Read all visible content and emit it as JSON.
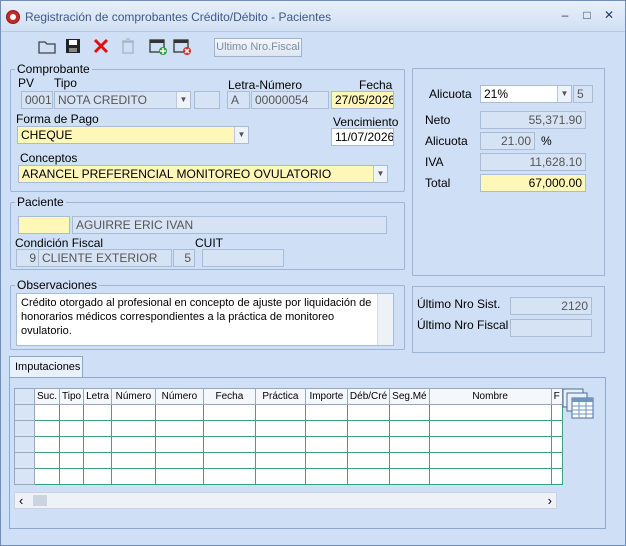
{
  "window": {
    "title": "Registración de comprobantes Crédito/Débito - Pacientes",
    "minimize": "‒",
    "maximize": "□",
    "close": "✕"
  },
  "toolbar": {
    "fiscal_label": "Ultimo Nro.Fiscal"
  },
  "comprobante": {
    "legend": "Comprobante",
    "pv_label": "PV",
    "pv_value": "0001",
    "tipo_label": "Tipo",
    "tipo_value": "NOTA CREDITO",
    "letra_numero_label": "Letra-Número",
    "letra_value": "A",
    "numero_value": "00000054",
    "fecha_label": "Fecha",
    "fecha_value": "27/05/2026",
    "forma_pago_label": "Forma de Pago",
    "forma_pago_value": "CHEQUE",
    "vencimiento_label": "Vencimiento",
    "vencimiento_value": "11/07/2026",
    "conceptos_label": "Conceptos",
    "conceptos_value": "ARANCEL PREFERENCIAL  MONITOREO OVULATORIO"
  },
  "paciente": {
    "legend": "Paciente",
    "codigo_value": "",
    "nombre_value": "AGUIRRE ERIC IVAN",
    "condicion_label": "Condición Fiscal",
    "condicion_code": "9",
    "condicion_value": "CLIENTE EXTERIOR",
    "cuit_label": "CUIT",
    "cuit_code": "5",
    "cuit_value": ""
  },
  "observaciones": {
    "legend": "Observaciones",
    "text": "Crédito otorgado al profesional en concepto de ajuste por liquidación de honorarios médicos correspondientes a la práctica de monitoreo ovulatorio."
  },
  "totales": {
    "alicuota_label": "Alicuota",
    "alicuota_select": "21%",
    "alicuota_code": "5",
    "neto_label": "Neto",
    "neto_value": "55,371.90",
    "alicuota2_label": "Alicuota",
    "alicuota2_value": "21.00",
    "pct_symbol": "%",
    "iva_label": "IVA",
    "iva_value": "11,628.10",
    "total_label": "Total",
    "total_value": "67,000.00"
  },
  "sistema": {
    "ultimo_sist_label": "Último Nro Sist.",
    "ultimo_sist_value": "2120",
    "ultimo_fiscal_label": "Último Nro Fiscal",
    "ultimo_fiscal_value": ""
  },
  "imputaciones": {
    "tab_label": "Imputaciones",
    "columns": [
      "Suc.",
      "Tipo",
      "Letra",
      "Número",
      "Número",
      "Fecha",
      "Práctica",
      "Importe",
      "Déb/Cré",
      "Seg.Mé",
      "Nombre",
      "F"
    ],
    "scroll_left": "‹",
    "scroll_right": "›"
  }
}
